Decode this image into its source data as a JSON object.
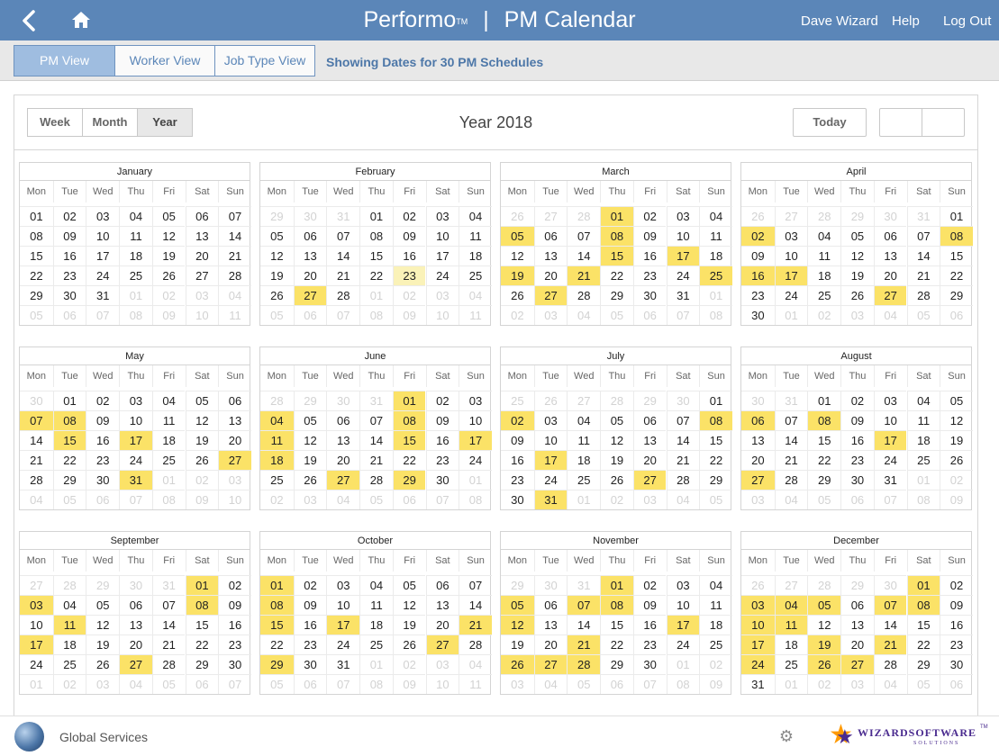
{
  "header": {
    "app_name": "Performo",
    "trademark": "TM",
    "separator": "|",
    "page_title": "PM Calendar",
    "user": "Dave Wizard",
    "help": "Help",
    "logout": "Log Out"
  },
  "view_tabs": {
    "pm": "PM View",
    "worker": "Worker View",
    "job_type": "Job Type View",
    "active": "pm",
    "status": "Showing Dates for 30 PM Schedules"
  },
  "calendar": {
    "range_buttons": {
      "week": "Week",
      "month": "Month",
      "year": "Year",
      "active": "year"
    },
    "title": "Year 2018",
    "today_label": "Today",
    "weekdays": [
      "Mon",
      "Tue",
      "Wed",
      "Thu",
      "Fri",
      "Sat",
      "Sun"
    ],
    "today": {
      "month": 2,
      "day": 23
    },
    "months": [
      {
        "name": "January",
        "first_weekday": 0,
        "days": 31,
        "pm": []
      },
      {
        "name": "February",
        "first_weekday": 3,
        "days": 28,
        "pm": [
          27
        ]
      },
      {
        "name": "March",
        "first_weekday": 3,
        "days": 31,
        "pm": [
          1,
          5,
          8,
          15,
          17,
          19,
          21,
          25,
          27
        ]
      },
      {
        "name": "April",
        "first_weekday": 6,
        "days": 30,
        "pm": [
          2,
          8,
          16,
          17,
          27
        ]
      },
      {
        "name": "May",
        "first_weekday": 1,
        "days": 31,
        "pm": [
          7,
          8,
          15,
          17,
          27,
          31
        ]
      },
      {
        "name": "June",
        "first_weekday": 4,
        "days": 30,
        "pm": [
          1,
          4,
          8,
          11,
          15,
          17,
          18,
          27,
          29
        ]
      },
      {
        "name": "July",
        "first_weekday": 6,
        "days": 31,
        "pm": [
          2,
          8,
          17,
          27,
          31
        ]
      },
      {
        "name": "August",
        "first_weekday": 2,
        "days": 31,
        "pm": [
          6,
          8,
          17,
          27
        ]
      },
      {
        "name": "September",
        "first_weekday": 5,
        "days": 30,
        "pm": [
          1,
          3,
          8,
          11,
          17,
          27
        ]
      },
      {
        "name": "October",
        "first_weekday": 0,
        "days": 31,
        "pm": [
          1,
          8,
          15,
          17,
          21,
          27,
          29
        ]
      },
      {
        "name": "November",
        "first_weekday": 3,
        "days": 30,
        "pm": [
          1,
          5,
          7,
          8,
          12,
          17,
          21,
          26,
          27,
          28
        ]
      },
      {
        "name": "December",
        "first_weekday": 5,
        "days": 31,
        "pm": [
          1,
          3,
          4,
          5,
          7,
          8,
          10,
          11,
          17,
          19,
          21,
          24,
          26,
          27
        ]
      }
    ]
  },
  "footer": {
    "company": "Global Services",
    "logo_text": "WIZARDSOFTWARE",
    "logo_sub": "SOLUTIONS",
    "logo_tm": "TM"
  },
  "colors": {
    "header_bg": "#5b86b8",
    "pm_highlight": "#fbe267",
    "today_highlight": "#faf2b8",
    "active_tab": "#9fbde0"
  },
  "icons": {
    "back": "chevron-left-icon",
    "home": "home-icon",
    "globe": "globe-icon",
    "settings": "gear-icon",
    "logo": "star-logo-icon"
  }
}
